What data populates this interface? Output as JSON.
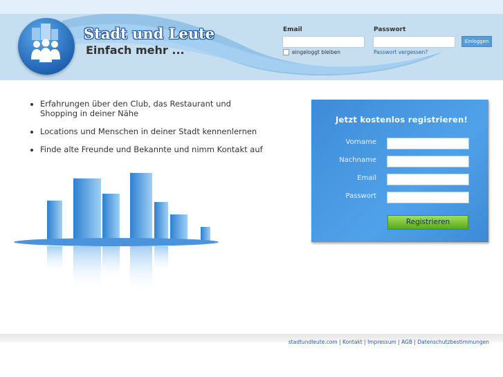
{
  "header": {
    "brand": "Stadt und Leute",
    "tagline": "Einfach mehr ...",
    "logo_icon": "city-people-icon"
  },
  "login": {
    "email_label": "Email",
    "password_label": "Passwort",
    "email_value": "",
    "password_value": "",
    "remember_label": "eingeloggt bleiben",
    "remember_checked": false,
    "forgot_link": "Passwort vergessen?",
    "submit_label": "Einloggen"
  },
  "features": [
    "Erfahrungen über den Club, das Restaurant und Shopping in deiner Nähe",
    "Locations und Menschen in deiner Stadt kennenlernen",
    "Finde alte Freunde und Bekannte und nimm Kontakt auf"
  ],
  "register": {
    "title": "Jetzt kostenlos registrieren!",
    "fields": [
      {
        "label": "Vorname",
        "value": ""
      },
      {
        "label": "Nachname",
        "value": ""
      },
      {
        "label": "Email",
        "value": ""
      },
      {
        "label": "Passwort",
        "value": ""
      }
    ],
    "submit_label": "Registrieren"
  },
  "footer": {
    "links": [
      "stadtundleute.com",
      "Kontakt",
      "Impressum",
      "AGB",
      "Datenschutzbestimmungen"
    ]
  },
  "colors": {
    "accent": "#4a97e0",
    "header_bg": "#c6dff0",
    "button_green": "#7cc53c"
  }
}
